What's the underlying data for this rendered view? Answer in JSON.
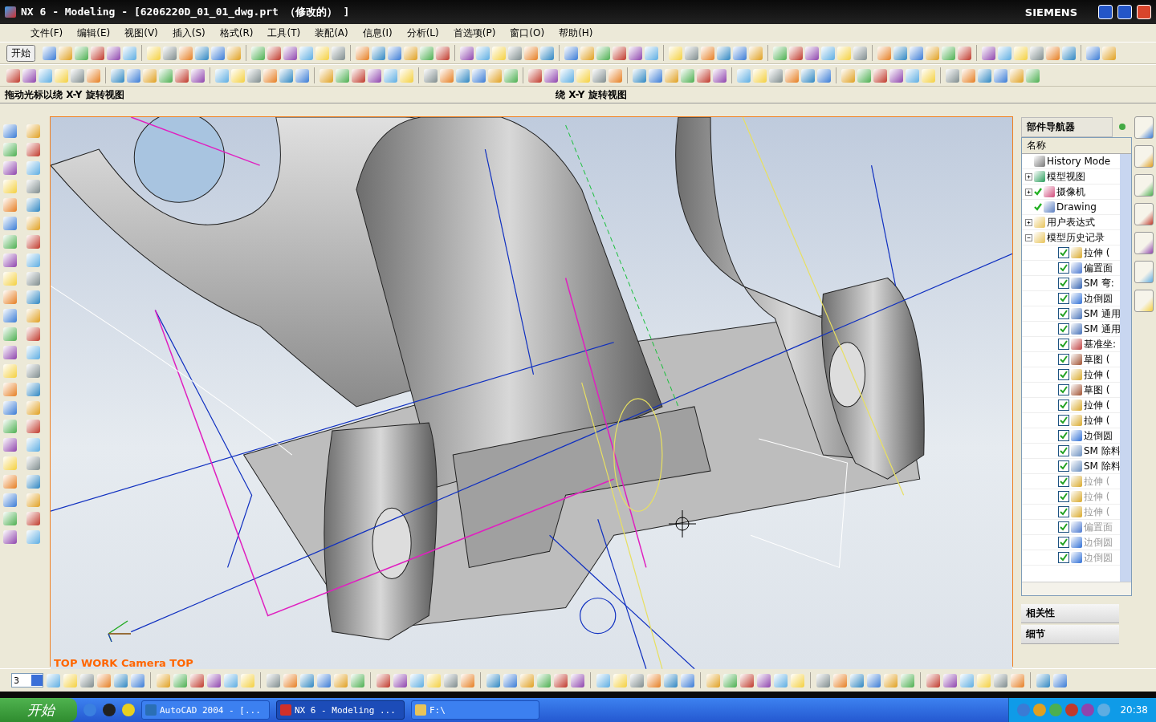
{
  "window": {
    "title": "NX 6 - Modeling - [6206220D_01_01_dwg.prt （修改的） ]",
    "brand": "SIEMENS"
  },
  "menu": [
    "文件(F)",
    "编辑(E)",
    "视图(V)",
    "插入(S)",
    "格式(R)",
    "工具(T)",
    "装配(A)",
    "信息(I)",
    "分析(L)",
    "首选项(P)",
    "窗口(O)",
    "帮助(H)"
  ],
  "toolbar": {
    "start_label": "开始"
  },
  "cue_line": {
    "prompt": "拖动光标以绕 X-Y 旋转视图",
    "status": "绕 X-Y 旋转视图"
  },
  "viewport": {
    "view_label": "TOP WORK Camera TOP"
  },
  "part_navigator": {
    "title": "部件导航器",
    "column": "名称",
    "tree": [
      {
        "label": "History Mode",
        "kind": "clock"
      },
      {
        "label": "模型视图",
        "kind": "views",
        "expanded": false
      },
      {
        "label": "摄像机",
        "kind": "camera",
        "expanded": false,
        "ticked": true
      },
      {
        "label": "Drawing",
        "kind": "drawing",
        "ticked": true
      },
      {
        "label": "用户表达式",
        "kind": "folder",
        "expanded": false
      },
      {
        "label": "模型历史记录",
        "kind": "folder",
        "expanded": true,
        "children": [
          {
            "label": "拉伸 (",
            "kind": "extrude",
            "checked": true,
            "disabled": false
          },
          {
            "label": "偏置面",
            "kind": "offset",
            "checked": true,
            "disabled": false
          },
          {
            "label": "SM 弯:",
            "kind": "bend",
            "checked": true,
            "disabled": false
          },
          {
            "label": "边倒圆",
            "kind": "blend",
            "checked": true,
            "disabled": false
          },
          {
            "label": "SM 通用",
            "kind": "sheet",
            "checked": true,
            "disabled": false
          },
          {
            "label": "SM 通用",
            "kind": "sheet",
            "checked": true,
            "disabled": false
          },
          {
            "label": "基准坐:",
            "kind": "csys",
            "checked": true,
            "disabled": false
          },
          {
            "label": "草图 (",
            "kind": "sketch",
            "checked": true,
            "disabled": false
          },
          {
            "label": "拉伸 (",
            "kind": "extrude",
            "checked": true,
            "disabled": false
          },
          {
            "label": "草图 (",
            "kind": "sketch",
            "checked": true,
            "disabled": false
          },
          {
            "label": "拉伸 (",
            "kind": "extrude",
            "checked": true,
            "disabled": false
          },
          {
            "label": "拉伸 (",
            "kind": "extrude",
            "checked": true,
            "disabled": false
          },
          {
            "label": "边倒圆",
            "kind": "blend",
            "checked": true,
            "disabled": false
          },
          {
            "label": "SM 除料",
            "kind": "cut",
            "checked": true,
            "disabled": false
          },
          {
            "label": "SM 除料",
            "kind": "cut",
            "checked": true,
            "disabled": false
          },
          {
            "label": "拉伸 (",
            "kind": "extrude",
            "checked": true,
            "disabled": true
          },
          {
            "label": "拉伸 (",
            "kind": "extrude",
            "checked": true,
            "disabled": true
          },
          {
            "label": "拉伸 (",
            "kind": "extrude",
            "checked": true,
            "disabled": true
          },
          {
            "label": "偏置面",
            "kind": "offset",
            "checked": true,
            "disabled": true
          },
          {
            "label": "边倒圆",
            "kind": "blend",
            "checked": true,
            "disabled": true
          },
          {
            "label": "边倒圆",
            "kind": "blend",
            "checked": true,
            "disabled": true
          }
        ]
      }
    ]
  },
  "panels": [
    {
      "label": "相关性"
    },
    {
      "label": "细节"
    }
  ],
  "bottom_toolbar": {
    "layer_value": "3"
  },
  "taskbar": {
    "start": "开始",
    "tasks": [
      {
        "label": "AutoCAD 2004 - [...",
        "kind": "autocad",
        "selected": false
      },
      {
        "label": "NX 6 - Modeling ...",
        "kind": "nx",
        "selected": true
      },
      {
        "label": "F:\\",
        "kind": "folder",
        "selected": false
      }
    ],
    "clock": "20:38"
  }
}
